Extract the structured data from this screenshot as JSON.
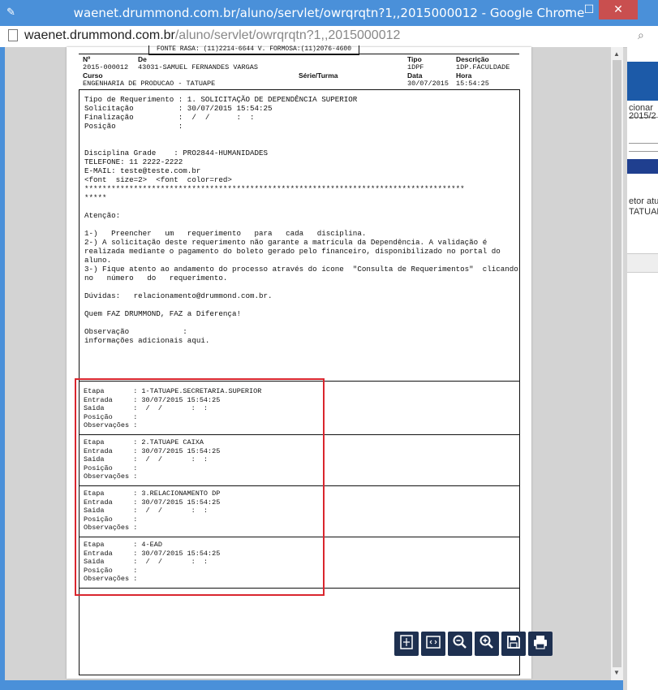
{
  "window": {
    "title": "waenet.drummond.com.br/aluno/servlet/owrqrqtn?1,,2015000012 - Google Chrome",
    "minimize": "–",
    "maximize": "☐",
    "close": "✕"
  },
  "address": {
    "host": "waenet.drummond.com.br",
    "path": "/aluno/servlet/owrqrqtn?1,,2015000012"
  },
  "background_app": {
    "items": [
      "cionar",
      "2015/2",
      "etor atua",
      "TATUAPE"
    ]
  },
  "document": {
    "fonte": "FONTE RASA: (11)2214-6644 V. FORMOSA:(11)2076-4600",
    "header": {
      "no_label": "Nº",
      "de_label": "De",
      "tipo_label": "Tipo",
      "descricao_label": "Descrição",
      "no_value": "2015-000012",
      "de_value": "43031-SAMUEL FERNANDES VARGAS",
      "tipo_value": "1DPF",
      "descricao_value": "1DP.FACULDADE",
      "curso_label": "Curso",
      "serie_label": "Série/Turma",
      "data_label": "Data",
      "hora_label": "Hora",
      "curso_value": "ENGENHARIA DE PRODUCAO - TATUAPE",
      "data_value": "30/07/2015",
      "hora_value": "15:54:25"
    },
    "body_lines": [
      "Tipo de Requerimento : 1. SOLICITAÇÃO DE DEPENDÊNCIA SUPERIOR",
      "Solicitação          : 30/07/2015 15:54:25",
      "Finalização          :  /  /      :  :",
      "Posição              :",
      "",
      "",
      "Disciplina Grade    : PRO2844-HUMANIDADES",
      "TELEFONE: 11 2222-2222",
      "E-MAIL: teste@teste.com.br",
      "<font  size=2>  <font  color=red>",
      "*************************************************************************************",
      "*****",
      "",
      "Atenção:",
      "",
      "1-)   Preencher   um   requerimento   para   cada   disciplina.",
      "2-) A solicitação deste requerimento não garante a matrícula da Dependência. A validação é",
      "realizada mediante o pagamento do boleto gerado pelo financeiro, disponibilizado no portal do",
      "aluno.",
      "3-) Fique atento ao andamento do processo através do ícone  \"Consulta de Requerimentos\"  clicando",
      "no   número   do   requerimento.",
      "",
      "Dúvidas:   relacionamento@drummond.com.br.",
      "",
      "Quem FAZ DRUMMOND, FAZ a Diferença!",
      "",
      "Observação            :",
      "informações adicionais aqui."
    ],
    "stages": [
      {
        "etapa": "Etapa       : 1-TATUAPE.SECRETARIA.SUPERIOR",
        "entrada": "Entrada     : 30/07/2015 15:54:25",
        "saida": "Saida       :  /  /       :  :",
        "posicao": "Posição     :",
        "observacoes": "Observações :"
      },
      {
        "etapa": "Etapa       : 2.TATUAPE CAIXA",
        "entrada": "Entrada     : 30/07/2015 15:54:25",
        "saida": "Saida       :  /  /       :  :",
        "posicao": "Posição     :",
        "observacoes": "Observações :"
      },
      {
        "etapa": "Etapa       : 3.RELACIONAMENTO DP",
        "entrada": "Entrada     : 30/07/2015 15:54:25",
        "saida": "Saida       :  /  /       :  :",
        "posicao": "Posição     :",
        "observacoes": "Observações :"
      },
      {
        "etapa": "Etapa       : 4-EAD",
        "entrada": "Entrada     : 30/07/2015 15:54:25",
        "saida": "Saida       :  /  /       :  :",
        "posicao": "Posição     :",
        "observacoes": "Observações :"
      }
    ]
  },
  "toolbar": {
    "buttons": [
      "fit-page-icon",
      "fit-width-icon",
      "zoom-out-icon",
      "zoom-in-icon",
      "save-icon",
      "print-icon"
    ]
  },
  "colors": {
    "chrome_frame": "#4a90d9",
    "close_button": "#c94f4f",
    "highlight": "#d9262e",
    "toolbar_button": "#1e3050"
  }
}
